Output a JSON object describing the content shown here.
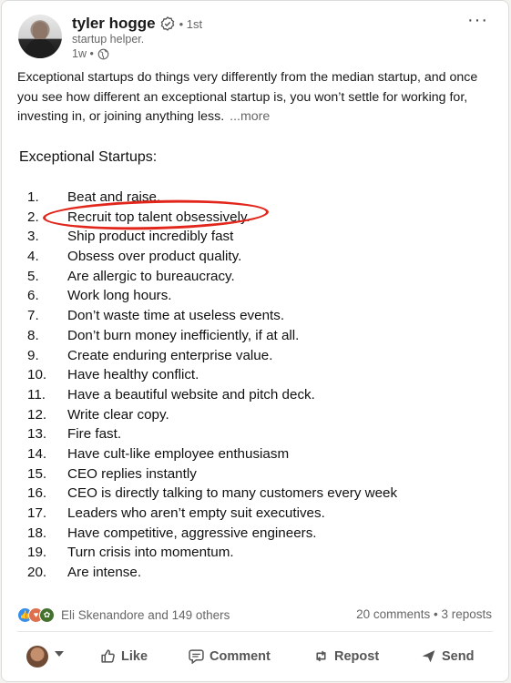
{
  "author": {
    "name": "tyler hogge",
    "degree": "• 1st",
    "tagline": "startup helper.",
    "time": "1w •"
  },
  "post": {
    "text": "Exceptional startups do things very differently from the median startup, and once you see how different an exceptional startup is, you won’t settle for working for, investing in, or joining anything less.",
    "more_label": "...more"
  },
  "image": {
    "title": "Exceptional Startups:",
    "items": [
      {
        "num": "1.",
        "text": "Beat and raise."
      },
      {
        "num": "2.",
        "text": "Recruit top talent obsessively."
      },
      {
        "num": "3.",
        "text": "Ship product incredibly fast"
      },
      {
        "num": "4.",
        "text": "Obsess over product quality."
      },
      {
        "num": "5.",
        "text": "Are allergic to bureaucracy."
      },
      {
        "num": "6.",
        "text": "Work long hours."
      },
      {
        "num": "7.",
        "text": "Don’t waste time at useless events."
      },
      {
        "num": "8.",
        "text": "Don’t burn money inefficiently, if at all."
      },
      {
        "num": "9.",
        "text": "Create enduring enterprise value."
      },
      {
        "num": "10.",
        "text": "Have healthy conflict."
      },
      {
        "num": "11.",
        "text": "Have a beautiful website and pitch deck."
      },
      {
        "num": "12.",
        "text": "Write clear copy."
      },
      {
        "num": "13.",
        "text": "Fire fast."
      },
      {
        "num": "14.",
        "text": "Have cult-like employee enthusiasm"
      },
      {
        "num": "15.",
        "text": "CEO replies instantly"
      },
      {
        "num": "16.",
        "text": "CEO is directly talking to many customers every week"
      },
      {
        "num": "17.",
        "text": "Leaders who aren’t empty suit executives."
      },
      {
        "num": "18.",
        "text": "Have competitive, aggressive engineers."
      },
      {
        "num": "19.",
        "text": "Turn crisis into momentum."
      },
      {
        "num": "20.",
        "text": "Are intense."
      }
    ],
    "highlight_color": "#e2261c"
  },
  "social": {
    "reactors": "Eli Skenandore and 149 others",
    "comments": "20 comments",
    "separator": "•",
    "reposts": "3 reposts"
  },
  "actions": {
    "like": "Like",
    "comment": "Comment",
    "repost": "Repost",
    "send": "Send"
  },
  "colors": {
    "like_reaction": "#378fe9",
    "love_reaction": "#df704d",
    "insight_reaction": "#44712e"
  }
}
